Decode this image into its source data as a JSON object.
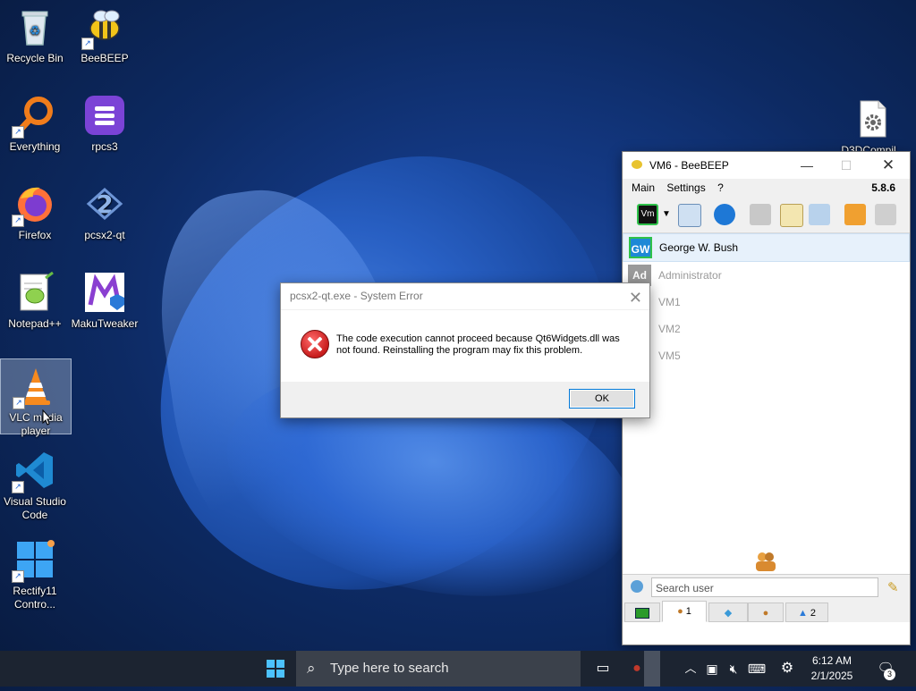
{
  "desktop": {
    "icons": [
      {
        "label": "Recycle Bin"
      },
      {
        "label": "BeeBEEP"
      },
      {
        "label": "Everything"
      },
      {
        "label": "rpcs3"
      },
      {
        "label": "Firefox"
      },
      {
        "label": "pcsx2-qt"
      },
      {
        "label": "Notepad++"
      },
      {
        "label": "MakuTweaker"
      },
      {
        "label": "VLC media player"
      },
      {
        "label": "Visual Studio Code"
      },
      {
        "label": "Rectify11 Contro..."
      },
      {
        "label": "D3DCompil..."
      }
    ]
  },
  "error_dialog": {
    "title": "pcsx2-qt.exe - System Error",
    "message": "The code execution cannot proceed because Qt6Widgets.dll was not found. Reinstalling the program may fix this problem.",
    "ok_label": "OK"
  },
  "beebeep": {
    "title": "VM6 - BeeBEEP",
    "menu": [
      "Main",
      "Settings",
      "?"
    ],
    "version": "5.8.6",
    "status_icon_label": "Vm",
    "users": [
      {
        "initials": "GW",
        "name": "George W. Bush",
        "color": "#1e88d6"
      },
      {
        "initials": "Ad",
        "name": "Administrator",
        "color": "#9a9a9a"
      },
      {
        "initials": "",
        "name": "VM1",
        "color": "#9a9a9a"
      },
      {
        "initials": "",
        "name": "VM2",
        "color": "#9a9a9a"
      },
      {
        "initials": "",
        "name": "VM5",
        "color": "#9a9a9a"
      }
    ],
    "search_placeholder": "Search user",
    "tabs": [
      {
        "label": ""
      },
      {
        "label": "1"
      },
      {
        "label": ""
      },
      {
        "label": ""
      },
      {
        "label": "2"
      }
    ]
  },
  "taskbar": {
    "search_placeholder": "Type here to search",
    "time": "6:12 AM",
    "date": "2/1/2025",
    "notification_count": "3"
  }
}
